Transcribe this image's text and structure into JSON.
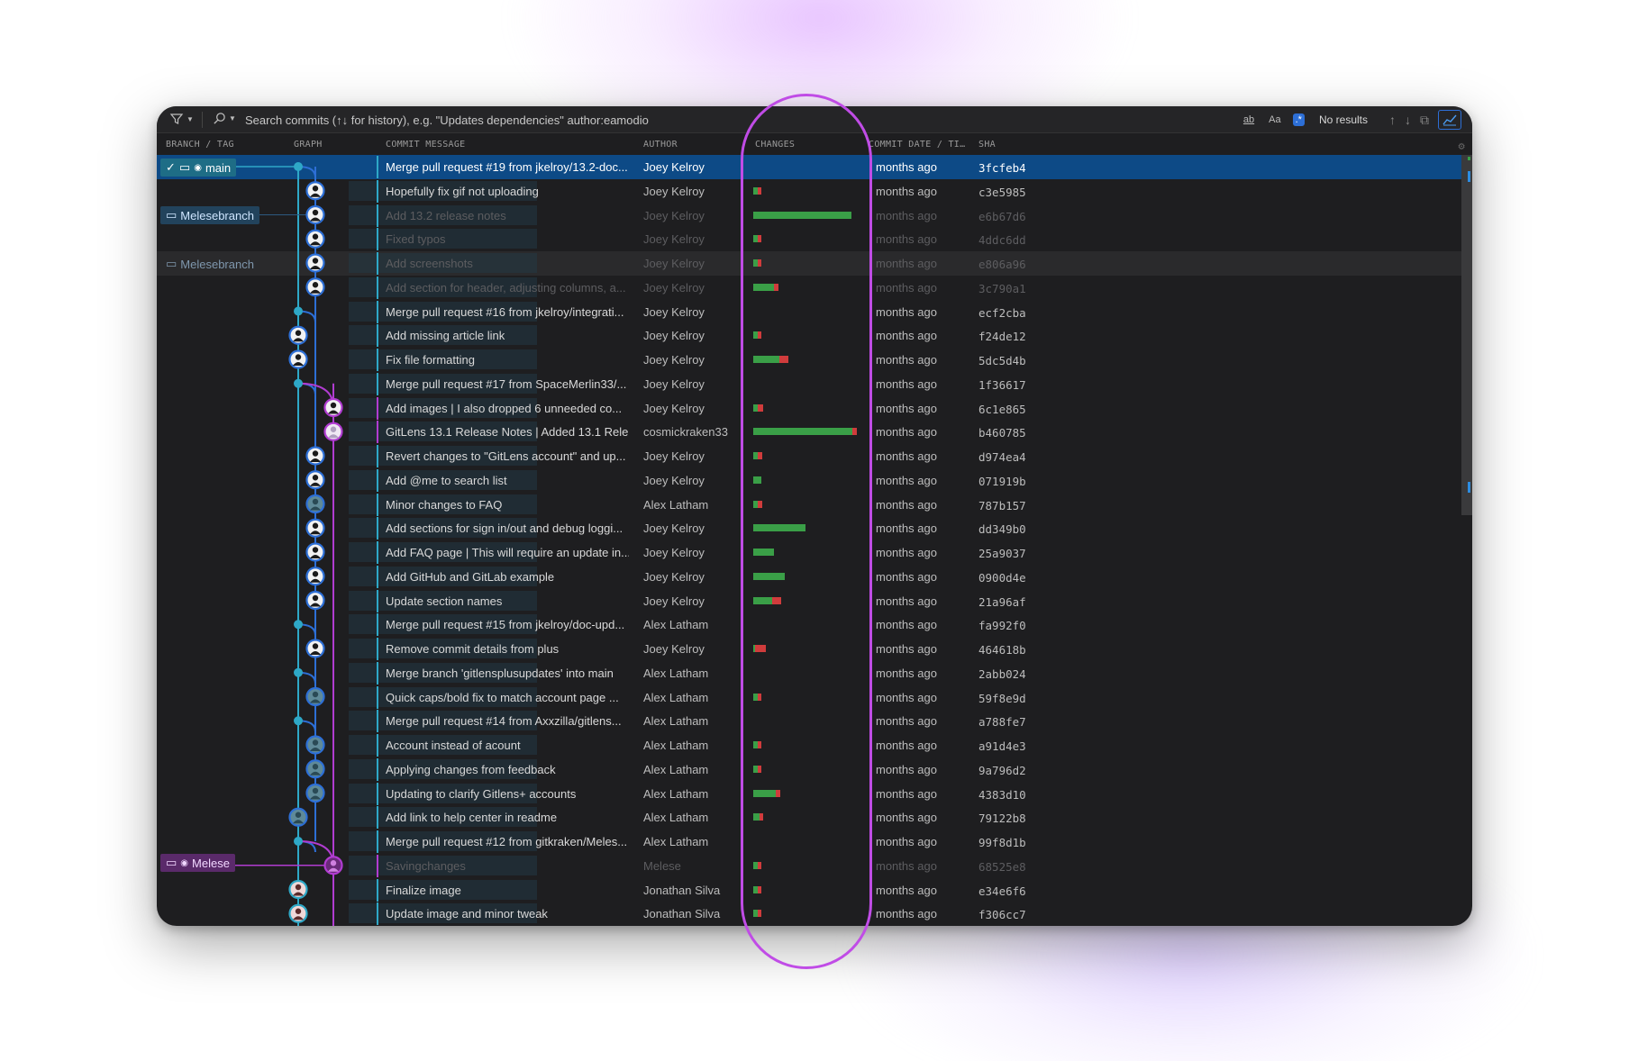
{
  "toolbar": {
    "search_placeholder": "Search commits (↑↓ for history), e.g. \"Updates dependencies\" author:eamodio",
    "opt_word": "ab",
    "opt_case": "Aa",
    "opt_regex": ".*",
    "no_results": "No results"
  },
  "columns": {
    "branch": "BRANCH / TAG",
    "graph": "GRAPH",
    "message": "COMMIT MESSAGE",
    "author": "AUTHOR",
    "changes": "CHANGES",
    "date": "COMMIT DATE / TI…",
    "sha": "SHA"
  },
  "branches": {
    "main": "main",
    "melesebranch": "Melesebranch",
    "melesebranch_remote": "Melesebranch",
    "melese": "Melese"
  },
  "colors": {
    "accent": "#2d6fd6",
    "graph_main": "#2ea8c7",
    "graph_secondary": "#2d6fd6",
    "graph_purple": "#b13cd1",
    "additions": "#3a9f47",
    "deletions": "#d03c3c",
    "highlight": "#c04ce6"
  },
  "commits": [
    {
      "message": "Merge pull request #19 from jkelroy/13.2-doc...",
      "author": "Joey Kelroy",
      "date": "months ago",
      "sha": "3fcfeb4",
      "add": 0,
      "del": 0
    },
    {
      "message": "Hopefully fix gif not uploading",
      "author": "Joey Kelroy",
      "date": "months ago",
      "sha": "c3e5985",
      "add": 4,
      "del": 4
    },
    {
      "message": "Add 13.2 release notes",
      "author": "Joey Kelroy",
      "date": "months ago",
      "sha": "e6b67d6",
      "add": 95,
      "del": 0
    },
    {
      "message": "Fixed typos",
      "author": "Joey Kelroy",
      "date": "months ago",
      "sha": "4ddc6dd",
      "add": 4,
      "del": 4
    },
    {
      "message": "Add screenshots",
      "author": "Joey Kelroy",
      "date": "months ago",
      "sha": "e806a96",
      "add": 4,
      "del": 4
    },
    {
      "message": "Add section for header, adjusting columns, a...",
      "author": "Joey Kelroy",
      "date": "months ago",
      "sha": "3c790a1",
      "add": 20,
      "del": 4
    },
    {
      "message": "Merge pull request #16 from jkelroy/integrati...",
      "author": "Joey Kelroy",
      "date": "months ago",
      "sha": "ecf2cba",
      "add": 0,
      "del": 0
    },
    {
      "message": "Add missing article link",
      "author": "Joey Kelroy",
      "date": "months ago",
      "sha": "f24de12",
      "add": 4,
      "del": 4
    },
    {
      "message": "Fix file formatting",
      "author": "Joey Kelroy",
      "date": "months ago",
      "sha": "5dc5d4b",
      "add": 25,
      "del": 9
    },
    {
      "message": "Merge pull request #17 from SpaceMerlin33/...",
      "author": "Joey Kelroy",
      "date": "months ago",
      "sha": "1f36617",
      "add": 0,
      "del": 0
    },
    {
      "message": "Add images | I also dropped 6 unneeded co...",
      "author": "Joey Kelroy",
      "date": "months ago",
      "sha": "6c1e865",
      "add": 4,
      "del": 6
    },
    {
      "message": "GitLens 13.1 Release Notes | Added 13.1 Rele...",
      "author": "cosmickraken33",
      "date": "months ago",
      "sha": "b460785",
      "add": 96,
      "del": 4
    },
    {
      "message": "Revert changes to \"GitLens account\" and up...",
      "author": "Joey Kelroy",
      "date": "months ago",
      "sha": "d974ea4",
      "add": 4,
      "del": 5
    },
    {
      "message": "Add @me to search list",
      "author": "Joey Kelroy",
      "date": "months ago",
      "sha": "071919b",
      "add": 8,
      "del": 0
    },
    {
      "message": "Minor changes to FAQ",
      "author": "Alex Latham",
      "date": "months ago",
      "sha": "787b157",
      "add": 4,
      "del": 5
    },
    {
      "message": "Add sections for sign in/out and debug loggi...",
      "author": "Joey Kelroy",
      "date": "months ago",
      "sha": "dd349b0",
      "add": 50,
      "del": 0
    },
    {
      "message": "Add FAQ page | This will require an update in...",
      "author": "Joey Kelroy",
      "date": "months ago",
      "sha": "25a9037",
      "add": 20,
      "del": 0
    },
    {
      "message": "Add GitHub and GitLab example",
      "author": "Joey Kelroy",
      "date": "months ago",
      "sha": "0900d4e",
      "add": 30,
      "del": 0
    },
    {
      "message": "Update section names",
      "author": "Joey Kelroy",
      "date": "months ago",
      "sha": "21a96af",
      "add": 18,
      "del": 9
    },
    {
      "message": "Merge pull request #15 from jkelroy/doc-upd...",
      "author": "Alex Latham",
      "date": "months ago",
      "sha": "fa992f0",
      "add": 0,
      "del": 0
    },
    {
      "message": "Remove commit details from plus",
      "author": "Joey Kelroy",
      "date": "months ago",
      "sha": "464618b",
      "add": 2,
      "del": 10
    },
    {
      "message": "Merge branch 'gitlensplusupdates' into main",
      "author": "Alex Latham",
      "date": "months ago",
      "sha": "2abb024",
      "add": 0,
      "del": 0
    },
    {
      "message": "Quick caps/bold fix to match account page ...",
      "author": "Alex Latham",
      "date": "months ago",
      "sha": "59f8e9d",
      "add": 4,
      "del": 4
    },
    {
      "message": "Merge pull request #14 from Axxzilla/gitlens...",
      "author": "Alex Latham",
      "date": "months ago",
      "sha": "a788fe7",
      "add": 0,
      "del": 0
    },
    {
      "message": "Account instead of acount",
      "author": "Alex Latham",
      "date": "months ago",
      "sha": "a91d4e3",
      "add": 4,
      "del": 4
    },
    {
      "message": "Applying changes from feedback",
      "author": "Alex Latham",
      "date": "months ago",
      "sha": "9a796d2",
      "add": 4,
      "del": 4
    },
    {
      "message": "Updating to clarify Gitlens+ accounts",
      "author": "Alex Latham",
      "date": "months ago",
      "sha": "4383d10",
      "add": 22,
      "del": 4
    },
    {
      "message": "Add link to help center in readme",
      "author": "Alex Latham",
      "date": "months ago",
      "sha": "79122b8",
      "add": 6,
      "del": 4
    },
    {
      "message": "Merge pull request #12 from gitkraken/Meles...",
      "author": "Alex Latham",
      "date": "months ago",
      "sha": "99f8d1b",
      "add": 0,
      "del": 0
    },
    {
      "message": "Savingchanges",
      "author": "Melese",
      "date": "months ago",
      "sha": "68525e8",
      "add": 4,
      "del": 4
    },
    {
      "message": "Finalize image",
      "author": "Jonathan Silva",
      "date": "months ago",
      "sha": "e34e6f6",
      "add": 4,
      "del": 4
    },
    {
      "message": "Update image and minor tweak",
      "author": "Jonathan Silva",
      "date": "months ago",
      "sha": "f306cc7",
      "add": 4,
      "del": 4
    }
  ]
}
